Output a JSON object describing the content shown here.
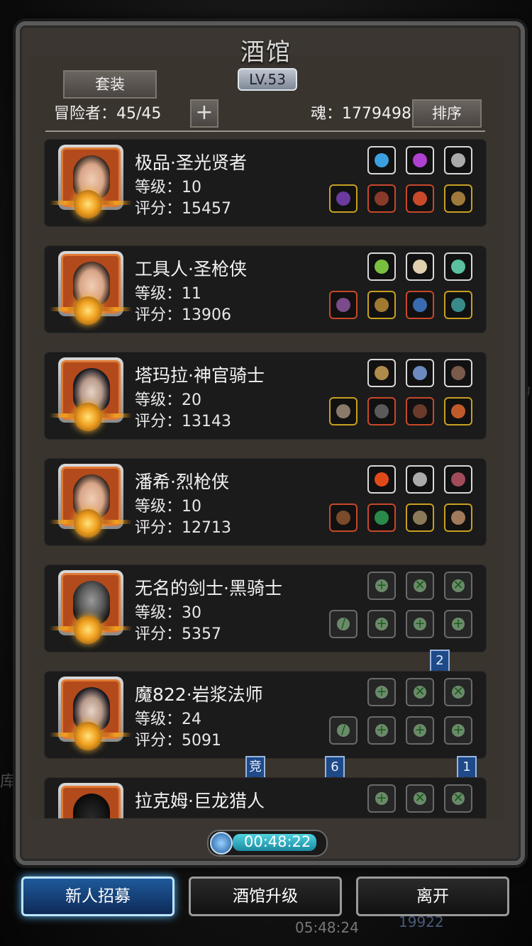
{
  "header": {
    "title": "酒馆",
    "level": "LV.53",
    "set_button": "套装",
    "adventurers": "冒险者：45/45",
    "add_button": "+",
    "soul": "魂：1779498",
    "sort_button": "排序"
  },
  "heroes": [
    {
      "name": "极品·圣光贤者",
      "level": "等级：10",
      "score": "评分：15457"
    },
    {
      "name": "工具人·圣枪侠",
      "level": "等级：11",
      "score": "评分：13906"
    },
    {
      "name": "塔玛拉·神官骑士",
      "level": "等级：20",
      "score": "评分：13143"
    },
    {
      "name": "潘希·烈枪侠",
      "level": "等级：10",
      "score": "评分：12713"
    },
    {
      "name": "无名的剑士·黑骑士",
      "level": "等级：30",
      "score": "评分：5357"
    },
    {
      "name": "魔822·岩浆法师",
      "level": "等级：24",
      "score": "评分：5091"
    },
    {
      "name": "拉克姆·巨龙猎人",
      "level": "",
      "score": ""
    }
  ],
  "flags": {
    "f2": "2",
    "jing": "竞",
    "f6": "6",
    "f1": "1"
  },
  "timer": "00:48:22",
  "buttons": {
    "recruit": "新人招募",
    "upgrade": "酒馆升级",
    "leave": "离开"
  },
  "background": {
    "right_text": "场",
    "left_text": "库",
    "bottom_time": "05:48:24",
    "bottom_soul": "19922"
  },
  "colors": {
    "card_bg": "#1b1b1b",
    "portrait_frame": "#e07a33",
    "active_button": "#1e5a9a"
  }
}
